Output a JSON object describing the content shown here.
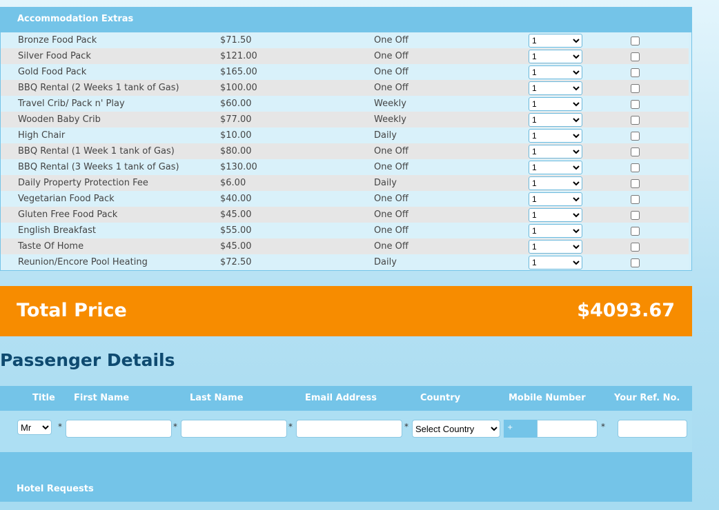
{
  "extras": {
    "title": "Accommodation Extras",
    "rows": [
      {
        "name": "Bronze Food Pack",
        "price": "$71.50",
        "freq": "One Off",
        "qty": "1"
      },
      {
        "name": "Silver Food Pack",
        "price": "$121.00",
        "freq": "One Off",
        "qty": "1"
      },
      {
        "name": "Gold Food Pack",
        "price": "$165.00",
        "freq": "One Off",
        "qty": "1"
      },
      {
        "name": "BBQ Rental (2 Weeks 1 tank of Gas)",
        "price": "$100.00",
        "freq": "One Off",
        "qty": "1"
      },
      {
        "name": "Travel Crib/ Pack n' Play",
        "price": "$60.00",
        "freq": "Weekly",
        "qty": "1"
      },
      {
        "name": "Wooden Baby Crib",
        "price": "$77.00",
        "freq": "Weekly",
        "qty": "1"
      },
      {
        "name": "High Chair",
        "price": "$10.00",
        "freq": "Daily",
        "qty": "1"
      },
      {
        "name": "BBQ Rental (1 Week 1 tank of Gas)",
        "price": "$80.00",
        "freq": "One Off",
        "qty": "1"
      },
      {
        "name": "BBQ Rental (3 Weeks 1 tank of Gas)",
        "price": "$130.00",
        "freq": "One Off",
        "qty": "1"
      },
      {
        "name": "Daily Property Protection Fee",
        "price": "$6.00",
        "freq": "Daily",
        "qty": "1"
      },
      {
        "name": "Vegetarian Food Pack",
        "price": "$40.00",
        "freq": "One Off",
        "qty": "1"
      },
      {
        "name": "Gluten Free Food Pack",
        "price": "$45.00",
        "freq": "One Off",
        "qty": "1"
      },
      {
        "name": "English Breakfast",
        "price": "$55.00",
        "freq": "One Off",
        "qty": "1"
      },
      {
        "name": "Taste Of Home",
        "price": "$45.00",
        "freq": "One Off",
        "qty": "1"
      },
      {
        "name": "Reunion/Encore Pool Heating",
        "price": "$72.50",
        "freq": "Daily",
        "qty": "1"
      }
    ]
  },
  "total": {
    "label": "Total Price",
    "value": "$4093.67"
  },
  "passenger": {
    "title": "Passenger Details",
    "headers": {
      "title": "Title",
      "first": "First Name",
      "last": "Last Name",
      "email": "Email Address",
      "country": "Country",
      "mobile": "Mobile Number",
      "ref": "Your Ref. No."
    },
    "title_value": "Mr",
    "country_value": "Select Country",
    "mobile_prefix": "+",
    "required": "*"
  },
  "hotel": {
    "title": "Hotel Requests"
  }
}
